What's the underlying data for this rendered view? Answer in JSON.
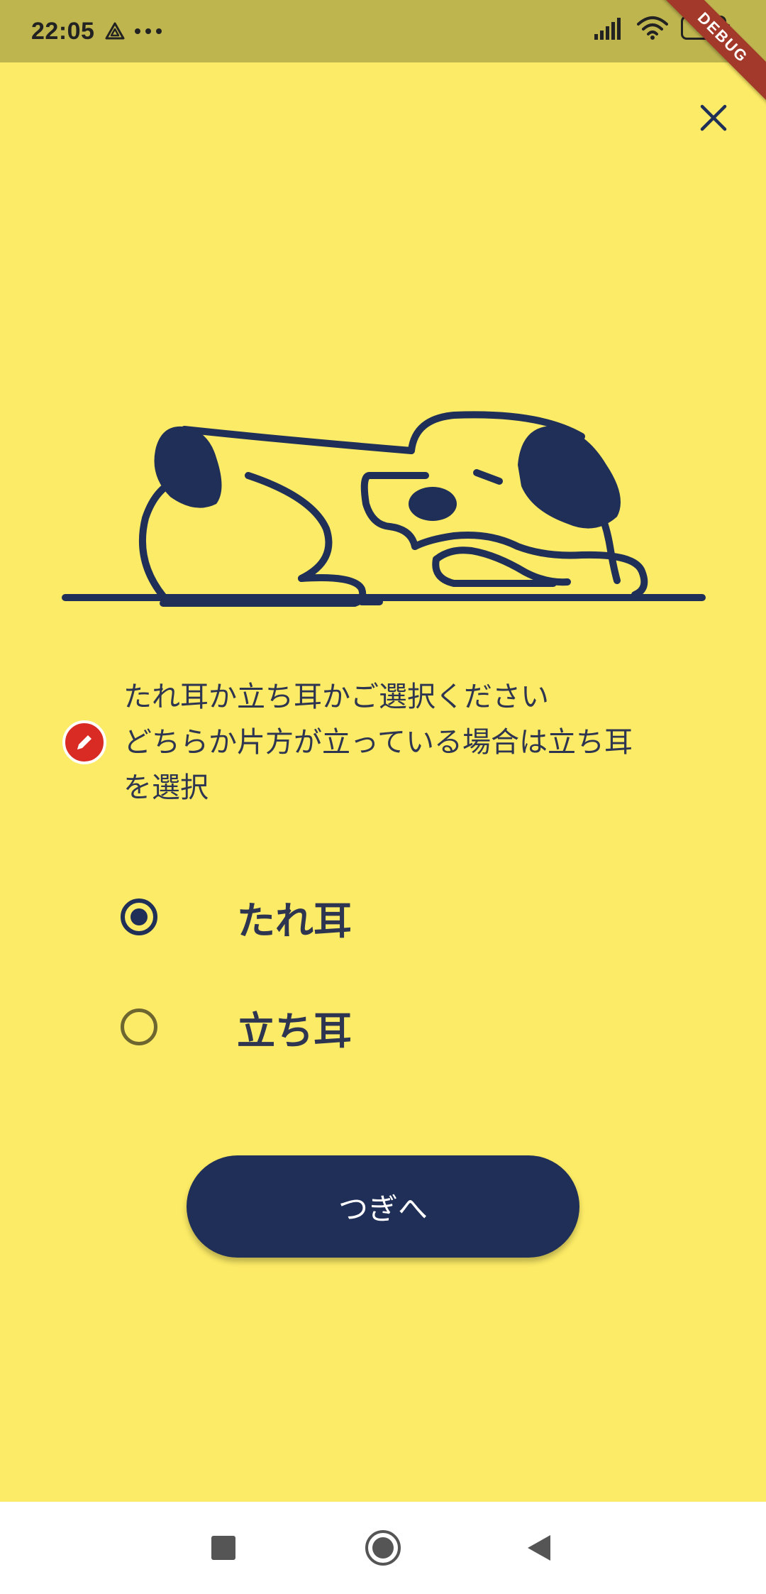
{
  "status_bar": {
    "time": "22:05",
    "battery_level": "34",
    "icons": [
      "drive-triangle-icon",
      "more-dots-icon",
      "signal-icon",
      "wifi-icon",
      "battery-icon"
    ]
  },
  "debug_banner": {
    "label": "DEBUG"
  },
  "instruction": {
    "lines": [
      "たれ耳か立ち耳かご選択ください",
      "どちらか片方が立っている場合は立ち耳",
      "を選択"
    ]
  },
  "options": [
    {
      "label": "たれ耳",
      "selected": true
    },
    {
      "label": "立ち耳",
      "selected": false
    }
  ],
  "next_button": {
    "label": "つぎへ"
  },
  "colors": {
    "background": "#FCEB66",
    "status_bar": "#BFB54E",
    "primary": "#1F2F57",
    "edit_badge": "#D92B24",
    "ribbon": "#A2392A"
  }
}
